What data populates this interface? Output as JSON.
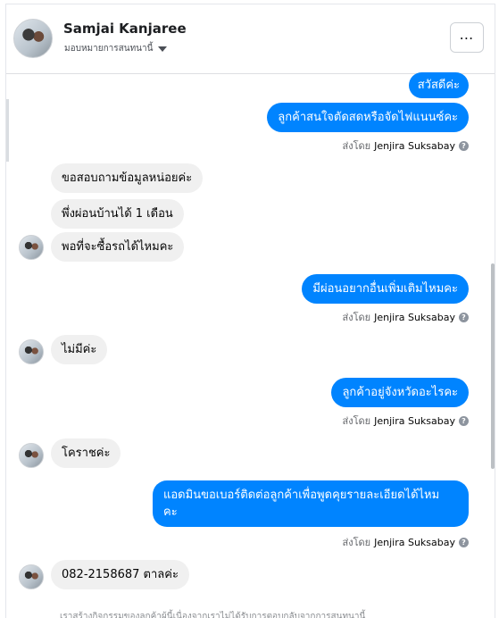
{
  "header": {
    "name": "Samjai Kanjaree",
    "assign_label": "มอบหมายการสนทนานี้",
    "more_label": "⋯"
  },
  "messages": [
    {
      "dir": "out",
      "text": "สวัสดีค่ะ"
    },
    {
      "dir": "out",
      "text": "ลูกค้าสนใจตัดสดหรือจัดไฟแนนซ์คะ"
    },
    {
      "dir": "in",
      "text": "ขอสอบถามข้อมูลหน่อยค่ะ"
    },
    {
      "dir": "in",
      "text": "พึ่งผ่อนบ้านได้ 1 เดือน"
    },
    {
      "dir": "in",
      "text": "พอที่จะซื้อรถได้ไหมคะ"
    },
    {
      "dir": "out",
      "text": "มีผ่อนอยากอื่นเพิ่มเติมไหมคะ"
    },
    {
      "dir": "in",
      "text": "ไม่มีค่ะ"
    },
    {
      "dir": "out",
      "text": "ลูกค้าอยู่จังหวัดอะไรคะ"
    },
    {
      "dir": "in",
      "text": "โคราชค่ะ"
    },
    {
      "dir": "out",
      "text": "แอดมินขอเบอร์ติดต่อลูกค้าเพื่อพูดคุยรายละเอียดได้ไหม"
    },
    {
      "dir": "out",
      "text": "คะ"
    },
    {
      "dir": "in",
      "text": "082-2158687 ตาลค่ะ"
    }
  ],
  "sender": {
    "prefix": "ส่งโดย",
    "name": "Jenjira Suksabay",
    "info_icon": "?"
  },
  "footer": {
    "text": "เราสร้างกิจกรรมของลูกค้าผู้นี้เนื่องจากเราไม่ได้รับการตอบกลับจากการสนทนานี้"
  },
  "icons": {
    "caret": "caret-down-icon",
    "more": "more-options-icon",
    "info": "question-icon"
  },
  "colors": {
    "outgoing_bubble": "#0084ff",
    "incoming_bubble": "#f0f0f0"
  }
}
